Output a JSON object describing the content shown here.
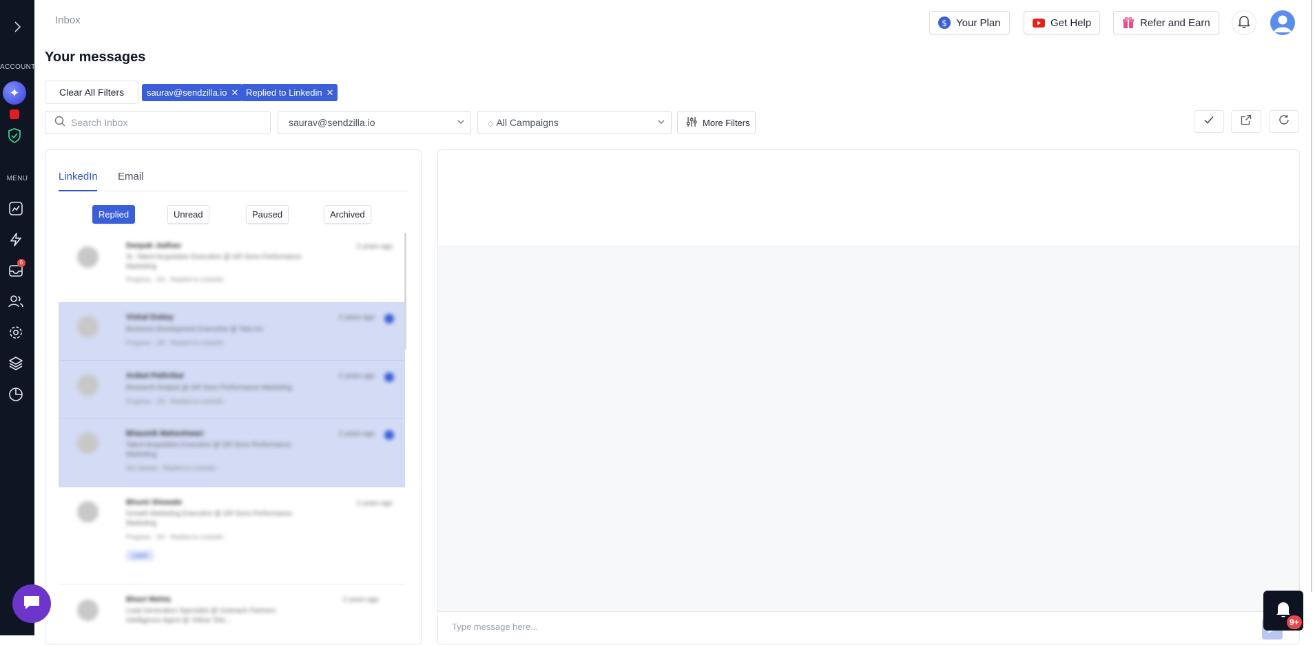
{
  "sidebar": {
    "expand_icon": "chevron-right-icon",
    "account_label": "ACCOUNT",
    "menu_label": "MENU",
    "inbox_badge": "6",
    "items": [
      {
        "name": "analytics",
        "icon": "chart-icon"
      },
      {
        "name": "campaigns",
        "icon": "lightning-icon"
      },
      {
        "name": "inbox",
        "icon": "inbox-icon"
      },
      {
        "name": "leads",
        "icon": "users-icon"
      },
      {
        "name": "settings",
        "icon": "gear-icon"
      },
      {
        "name": "integrations",
        "icon": "layers-icon"
      },
      {
        "name": "reports",
        "icon": "pie-chart-icon"
      }
    ]
  },
  "header": {
    "breadcrumb": "Inbox",
    "your_plan": "Your Plan",
    "get_help": "Get Help",
    "refer_earn": "Refer and Earn"
  },
  "page": {
    "title": "Your messages"
  },
  "filters": {
    "clear_all": "Clear All Filters",
    "chips": [
      "saurav@sendzilla.io",
      "Replied to Linkedin"
    ],
    "search_placeholder": "Search Inbox",
    "account_select": "saurav@sendzilla.io",
    "campaign_select": "All Campaigns",
    "more_filters": "More Filters"
  },
  "messages_panel": {
    "tabs": [
      "LinkedIn",
      "Email"
    ],
    "active_tab": "LinkedIn",
    "status_filters": [
      "Replied",
      "Unread",
      "Paused",
      "Archived"
    ],
    "active_status": "Replied",
    "items": [
      {
        "name": "Deepak Jadhav",
        "line1": "Sr. Talent Acquisition Executive @ GR Sons Performance",
        "line2": "Marketing",
        "meta": "Progress · 3/3 · Replied to LinkedIn",
        "time": "2 years ago",
        "selected": false,
        "unread": false,
        "tag": ""
      },
      {
        "name": "Vishal Dubey",
        "line1": "Business Development Executive @ Tata Inc",
        "line2": "",
        "meta": "Progress · 3/5 · Replied to LinkedIn",
        "time": "2 years ago",
        "selected": true,
        "unread": true,
        "tag": ""
      },
      {
        "name": "Aniket Pathrikar",
        "line1": "Research Analyst @ GR Sons Performance Marketing",
        "line2": "",
        "meta": "Progress · 2/5 · Replied to LinkedIn",
        "time": "2 years ago",
        "selected": true,
        "unread": true,
        "tag": ""
      },
      {
        "name": "Bhaumik Maheshwari",
        "line1": "Talent Acquisition Executive @ GR Sons Performance",
        "line2": "Marketing",
        "meta": "Not Started · Replied to LinkedIn",
        "time": "2 years ago",
        "selected": true,
        "unread": true,
        "tag": ""
      },
      {
        "name": "Bhumi Shewale",
        "line1": "Growth Marketing Executive @ GR Sons Performance",
        "line2": "Marketing",
        "meta": "Progress · 3/3 · Replied to LinkedIn",
        "time": "2 years ago",
        "selected": false,
        "unread": false,
        "tag": "Label"
      },
      {
        "name": "Bhavi Mehta",
        "line1": "Lead Generation Specialist @ Outreach Partners",
        "line2": "Intelligence Agent @ Yellow Tele...",
        "meta": "",
        "time": "2 years ago",
        "selected": false,
        "unread": false,
        "tag": ""
      }
    ]
  },
  "conversation": {
    "compose_placeholder": "Type message here..."
  },
  "notifications": {
    "badge": "9+"
  },
  "colors": {
    "sidebar_bg": "#0f1522",
    "accent": "#3a5fd9",
    "chat_fab": "#6d35c9"
  }
}
